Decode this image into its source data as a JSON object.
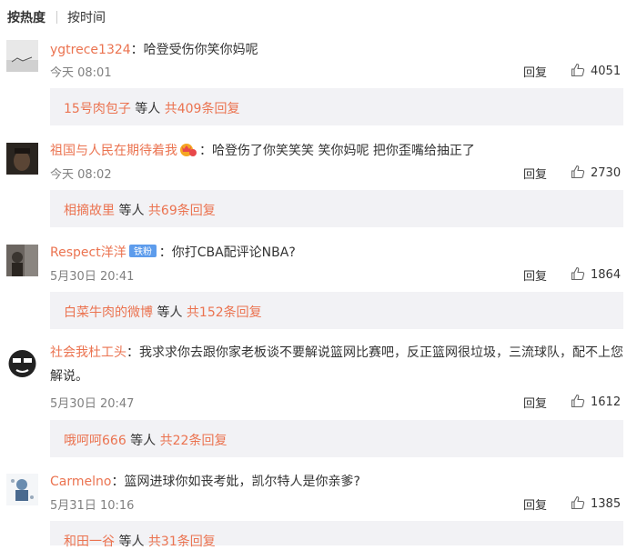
{
  "tabs": {
    "hot": "按热度",
    "time": "按时间"
  },
  "reply_label": "回复",
  "comments": [
    {
      "username": "ygtrece1324",
      "text": "：哈登受伤你笑你妈呢",
      "time": "今天 08:01",
      "likes": "4051",
      "sub": {
        "user": "15号肉包子",
        "mid": " 等人 ",
        "count": "共409条回复"
      }
    },
    {
      "username": "祖国与人民在期待着我",
      "text": "：哈登伤了你笑笑笑 笑你妈呢 把你歪嘴给抽正了",
      "time": "今天 08:02",
      "likes": "2730",
      "sub": {
        "user": "相摘故里",
        "mid": " 等人 ",
        "count": "共69条回复"
      }
    },
    {
      "username": "Respect洋洋",
      "badge": "铁粉",
      "text": "：你打CBA配评论NBA?",
      "time": "5月30日 20:41",
      "likes": "1864",
      "sub": {
        "user": "白菜牛肉的微博",
        "mid": " 等人 ",
        "count": "共152条回复"
      }
    },
    {
      "username": "社会我杜工头",
      "text": "：我求求你去跟你家老板谈不要解说篮网比赛吧，反正篮网很垃圾，三流球队，配不上您解说。",
      "time": "5月30日 20:47",
      "likes": "1612",
      "sub": {
        "user": "哦呵呵666",
        "mid": " 等人 ",
        "count": "共22条回复"
      }
    },
    {
      "username": "Carmelno",
      "text": "：篮网进球你如丧考妣，凯尔特人是你亲爹?",
      "time": "5月31日 10:16",
      "likes": "1385",
      "sub": {
        "user": "和田一谷",
        "mid": " 等人 ",
        "count": "共31条回复"
      }
    }
  ],
  "colors": {
    "accent": "#eb7350",
    "text": "#333333",
    "muted": "#808080",
    "subbox_bg": "#f2f2f5",
    "badge": "#5d9cec"
  },
  "icons": [
    "thumbs-up-icon",
    "crown-badge-icon",
    "fan-badge-icon"
  ]
}
